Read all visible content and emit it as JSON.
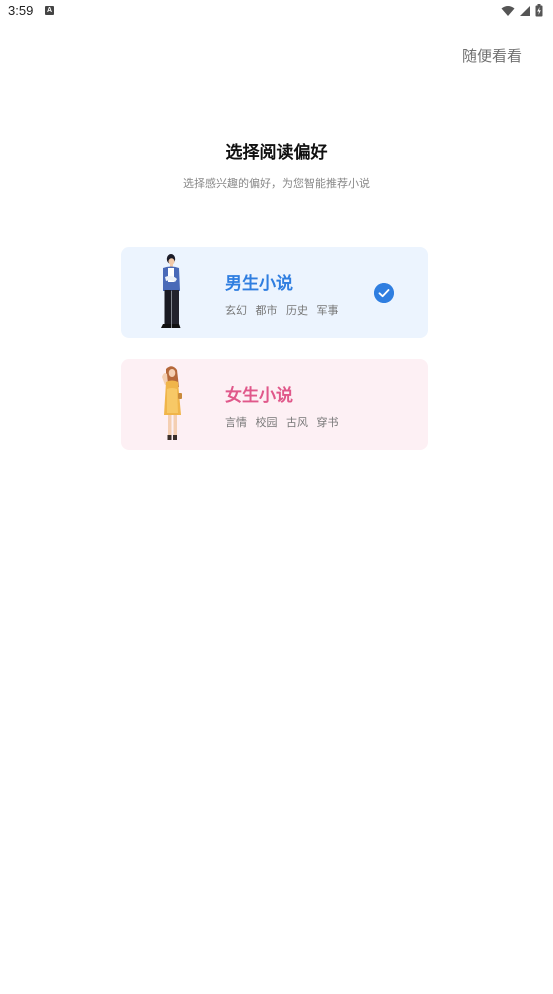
{
  "status_bar": {
    "time": "3:59",
    "notification_icon": "A"
  },
  "header": {
    "skip_label": "随便看看"
  },
  "main": {
    "title": "选择阅读偏好",
    "subtitle": "选择感兴趣的偏好，为您智能推荐小说"
  },
  "options": [
    {
      "title": "男生小说",
      "tags": [
        "玄幻",
        "都市",
        "历史",
        "军事"
      ],
      "selected": true,
      "accent": "#2f7ee0",
      "background": "#ecf4fe",
      "icon": "male-reader-illustration"
    },
    {
      "title": "女生小说",
      "tags": [
        "言情",
        "校园",
        "古风",
        "穿书"
      ],
      "selected": false,
      "accent": "#e0588a",
      "background": "#fdf0f4",
      "icon": "female-reader-illustration"
    }
  ]
}
